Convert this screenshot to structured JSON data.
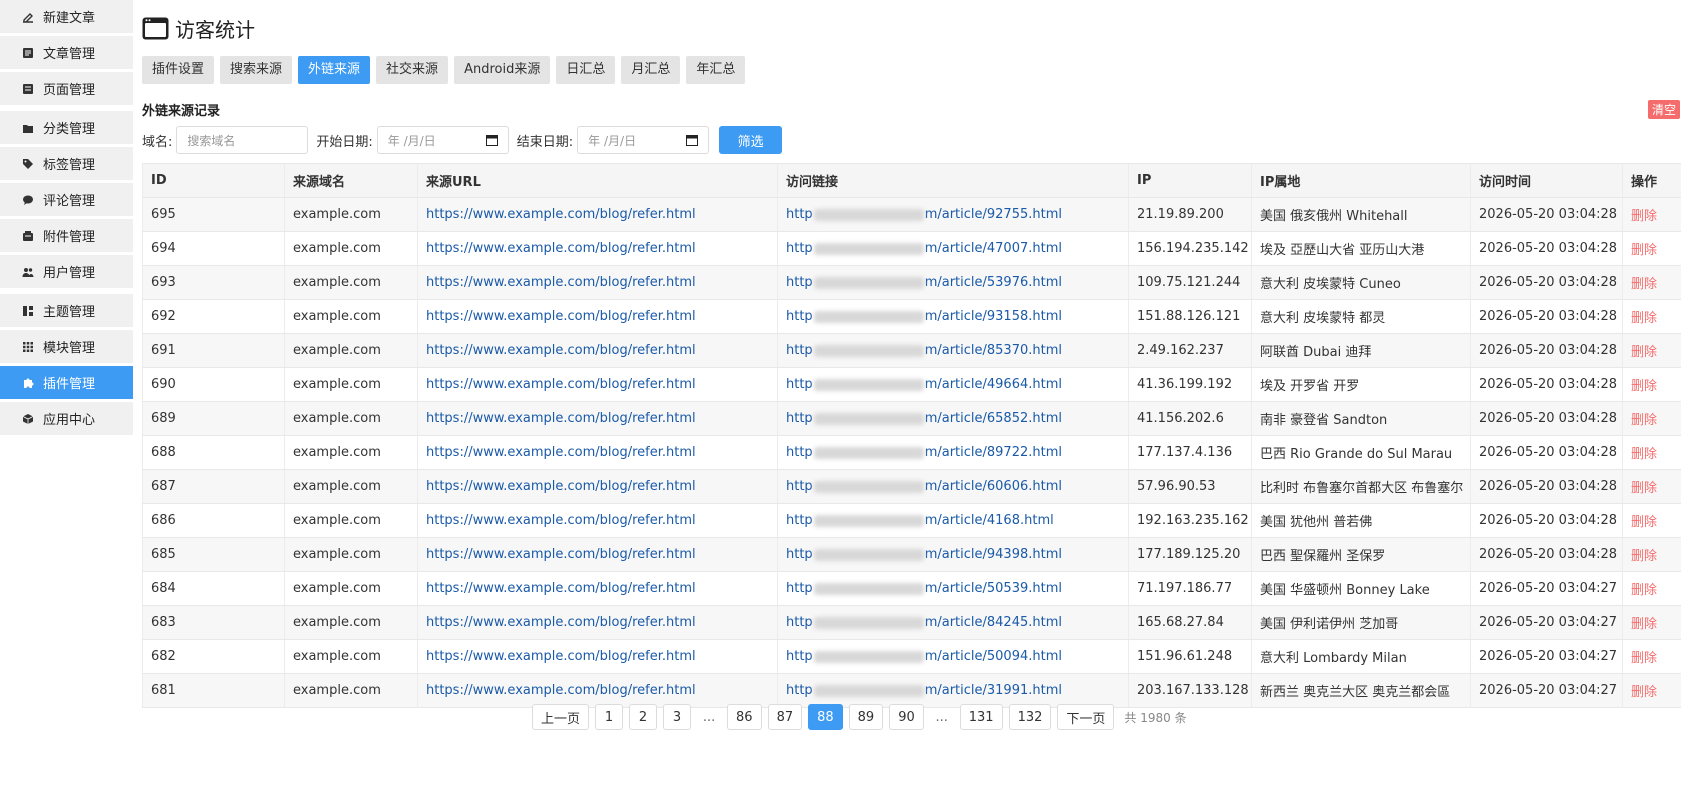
{
  "sidebar": {
    "groups": [
      [
        {
          "label": "新建文章",
          "icon": "edit-icon"
        },
        {
          "label": "文章管理",
          "icon": "article-icon"
        },
        {
          "label": "页面管理",
          "icon": "page-icon"
        }
      ],
      [
        {
          "label": "分类管理",
          "icon": "folder-icon"
        },
        {
          "label": "标签管理",
          "icon": "tag-icon"
        },
        {
          "label": "评论管理",
          "icon": "comment-icon"
        },
        {
          "label": "附件管理",
          "icon": "attachment-icon"
        },
        {
          "label": "用户管理",
          "icon": "users-icon"
        }
      ],
      [
        {
          "label": "主题管理",
          "icon": "theme-icon"
        },
        {
          "label": "模块管理",
          "icon": "grid-icon"
        },
        {
          "label": "插件管理",
          "icon": "puzzle-icon",
          "active": true
        },
        {
          "label": "应用中心",
          "icon": "cube-icon"
        }
      ]
    ]
  },
  "header": {
    "title": "访客统计"
  },
  "tabs": [
    {
      "label": "插件设置"
    },
    {
      "label": "搜索来源"
    },
    {
      "label": "外链来源",
      "active": true
    },
    {
      "label": "社交来源"
    },
    {
      "label": "Android来源"
    },
    {
      "label": "日汇总"
    },
    {
      "label": "月汇总"
    },
    {
      "label": "年汇总"
    }
  ],
  "section": {
    "title": "外链来源记录",
    "clear_label": "清空"
  },
  "filters": {
    "domain_label": "域名:",
    "domain_placeholder": "搜索域名",
    "start_label": "开始日期:",
    "end_label": "结束日期:",
    "date_placeholder": "年 /月/日",
    "filter_button": "筛选"
  },
  "table": {
    "headers": [
      "ID",
      "来源域名",
      "来源URL",
      "访问链接",
      "IP",
      "IP属地",
      "访问时间",
      "操作"
    ],
    "rows": [
      {
        "id": "695",
        "domain": "example.com",
        "url": "https://www.example.com/blog/refer.html",
        "visit_prefix": "http",
        "visit_suffix": "m/article/92755.html",
        "ip": "21.19.89.200",
        "loc": "美国 俄亥俄州 Whitehall",
        "time": "2026-05-20 03:04:28",
        "action": "删除"
      },
      {
        "id": "694",
        "domain": "example.com",
        "url": "https://www.example.com/blog/refer.html",
        "visit_prefix": "http",
        "visit_suffix": "m/article/47007.html",
        "ip": "156.194.235.142",
        "loc": "埃及 亞歷山大省 亚历山大港",
        "time": "2026-05-20 03:04:28",
        "action": "删除"
      },
      {
        "id": "693",
        "domain": "example.com",
        "url": "https://www.example.com/blog/refer.html",
        "visit_prefix": "http",
        "visit_suffix": "m/article/53976.html",
        "ip": "109.75.121.244",
        "loc": "意大利 皮埃蒙特 Cuneo",
        "time": "2026-05-20 03:04:28",
        "action": "删除"
      },
      {
        "id": "692",
        "domain": "example.com",
        "url": "https://www.example.com/blog/refer.html",
        "visit_prefix": "http",
        "visit_suffix": "m/article/93158.html",
        "ip": "151.88.126.121",
        "loc": "意大利 皮埃蒙特 都灵",
        "time": "2026-05-20 03:04:28",
        "action": "删除"
      },
      {
        "id": "691",
        "domain": "example.com",
        "url": "https://www.example.com/blog/refer.html",
        "visit_prefix": "http",
        "visit_suffix": "m/article/85370.html",
        "ip": "2.49.162.237",
        "loc": "阿联酋 Dubai 迪拜",
        "time": "2026-05-20 03:04:28",
        "action": "删除"
      },
      {
        "id": "690",
        "domain": "example.com",
        "url": "https://www.example.com/blog/refer.html",
        "visit_prefix": "http",
        "visit_suffix": "m/article/49664.html",
        "ip": "41.36.199.192",
        "loc": "埃及 开罗省 开罗",
        "time": "2026-05-20 03:04:28",
        "action": "删除"
      },
      {
        "id": "689",
        "domain": "example.com",
        "url": "https://www.example.com/blog/refer.html",
        "visit_prefix": "http",
        "visit_suffix": "m/article/65852.html",
        "ip": "41.156.202.6",
        "loc": "南非 豪登省 Sandton",
        "time": "2026-05-20 03:04:28",
        "action": "删除"
      },
      {
        "id": "688",
        "domain": "example.com",
        "url": "https://www.example.com/blog/refer.html",
        "visit_prefix": "http",
        "visit_suffix": "m/article/89722.html",
        "ip": "177.137.4.136",
        "loc": "巴西 Rio Grande do Sul Marau",
        "time": "2026-05-20 03:04:28",
        "action": "删除"
      },
      {
        "id": "687",
        "domain": "example.com",
        "url": "https://www.example.com/blog/refer.html",
        "visit_prefix": "http",
        "visit_suffix": "m/article/60606.html",
        "ip": "57.96.90.53",
        "loc": "比利时 布鲁塞尔首都大区 布鲁塞尔",
        "time": "2026-05-20 03:04:28",
        "action": "删除"
      },
      {
        "id": "686",
        "domain": "example.com",
        "url": "https://www.example.com/blog/refer.html",
        "visit_prefix": "http",
        "visit_suffix": "m/article/4168.html",
        "ip": "192.163.235.162",
        "loc": "美国 犹他州 普若佛",
        "time": "2026-05-20 03:04:28",
        "action": "删除"
      },
      {
        "id": "685",
        "domain": "example.com",
        "url": "https://www.example.com/blog/refer.html",
        "visit_prefix": "http",
        "visit_suffix": "m/article/94398.html",
        "ip": "177.189.125.20",
        "loc": "巴西 聖保羅州 圣保罗",
        "time": "2026-05-20 03:04:28",
        "action": "删除"
      },
      {
        "id": "684",
        "domain": "example.com",
        "url": "https://www.example.com/blog/refer.html",
        "visit_prefix": "http",
        "visit_suffix": "m/article/50539.html",
        "ip": "71.197.186.77",
        "loc": "美国 华盛顿州 Bonney Lake",
        "time": "2026-05-20 03:04:27",
        "action": "删除"
      },
      {
        "id": "683",
        "domain": "example.com",
        "url": "https://www.example.com/blog/refer.html",
        "visit_prefix": "http",
        "visit_suffix": "m/article/84245.html",
        "ip": "165.68.27.84",
        "loc": "美国 伊利诺伊州 芝加哥",
        "time": "2026-05-20 03:04:27",
        "action": "删除"
      },
      {
        "id": "682",
        "domain": "example.com",
        "url": "https://www.example.com/blog/refer.html",
        "visit_prefix": "http",
        "visit_suffix": "m/article/50094.html",
        "ip": "151.96.61.248",
        "loc": "意大利 Lombardy Milan",
        "time": "2026-05-20 03:04:27",
        "action": "删除"
      },
      {
        "id": "681",
        "domain": "example.com",
        "url": "https://www.example.com/blog/refer.html",
        "visit_prefix": "http",
        "visit_suffix": "m/article/31991.html",
        "ip": "203.167.133.128",
        "loc": "新西兰 奥克兰大区 奥克兰都会區",
        "time": "2026-05-20 03:04:27",
        "action": "删除"
      }
    ]
  },
  "pagination": {
    "prev": "上一页",
    "next": "下一页",
    "ellipsis": "...",
    "pages_left": [
      "1",
      "2",
      "3"
    ],
    "pages_mid": [
      "86",
      "87",
      "88",
      "89",
      "90"
    ],
    "pages_right": [
      "131",
      "132"
    ],
    "current": "88",
    "total": "共 1980 条"
  }
}
